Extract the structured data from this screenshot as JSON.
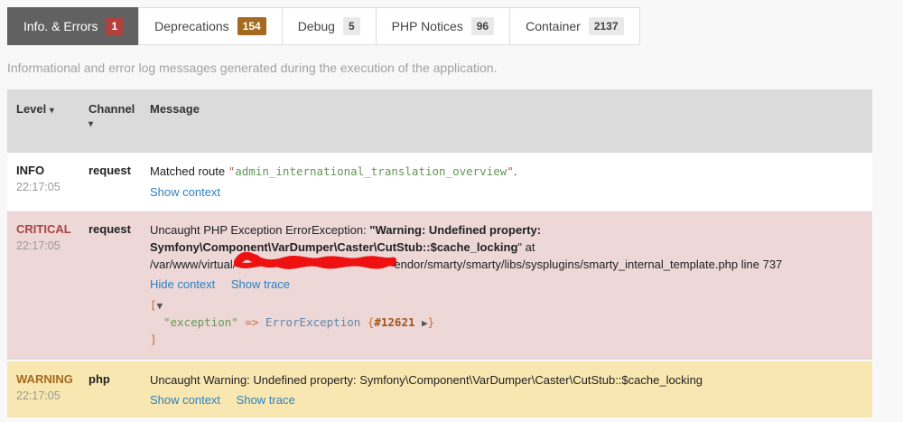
{
  "tabs": [
    {
      "label": "Info. & Errors",
      "badge": "1",
      "active": true
    },
    {
      "label": "Deprecations",
      "badge": "154",
      "active": false
    },
    {
      "label": "Debug",
      "badge": "5",
      "active": false
    },
    {
      "label": "PHP Notices",
      "badge": "96",
      "active": false
    },
    {
      "label": "Container",
      "badge": "2137",
      "active": false
    }
  ],
  "description": "Informational and error log messages generated during the execution of the application.",
  "table": {
    "headers": {
      "level": {
        "label": "Level",
        "sort_icon": "▾"
      },
      "channel": {
        "label": "Channel",
        "sort_icon": "▾"
      },
      "message": {
        "label": "Message"
      }
    },
    "rows": [
      {
        "level": "INFO",
        "time": "22:17:05",
        "channel": "request",
        "msg_prefix": "Matched route ",
        "route_open_quote": "\"",
        "route_name": "admin_international_translation_overview",
        "route_close_quote": "\"",
        "msg_suffix": ".",
        "links": [
          "Show context"
        ]
      },
      {
        "level": "CRITICAL",
        "time": "22:17:05",
        "channel": "request",
        "msg_part1": "Uncaught PHP Exception ErrorException: ",
        "msg_bold": "\"Warning: Undefined property: Symfony\\Component\\VarDumper\\Caster\\CutStub::$cache_locking",
        "msg_part2": "\" at ",
        "path_prefix": "/var/www/virtual/",
        "path_suffix": "endor/smarty/smarty/libs/sysplugins/smarty_internal_template.php line 737",
        "links": [
          "Hide context",
          "Show trace"
        ],
        "dump": {
          "bracket_open": "[",
          "caret_down": "▼",
          "key": "\"exception\"",
          "arrow": "=>",
          "class_name": "ErrorException",
          "brace_open": "{",
          "ref": "#12621",
          "caret_right": "▶",
          "brace_close": "}",
          "bracket_close": "]"
        }
      },
      {
        "level": "WARNING",
        "time": "22:17:05",
        "channel": "php",
        "message": "Uncaught Warning: Undefined property: Symfony\\Component\\VarDumper\\Caster\\CutStub::$cache_locking",
        "links": [
          "Show context",
          "Show trace"
        ]
      }
    ]
  },
  "colors": {
    "active_tab_bg": "#616161",
    "badge_error": "#b0413e",
    "badge_deprecation": "#a46a1f",
    "row_error_bg": "#edd7d7",
    "row_warning_bg": "#f8e7b0",
    "link": "#2f81c2",
    "scribble_red": "#ee1111"
  }
}
